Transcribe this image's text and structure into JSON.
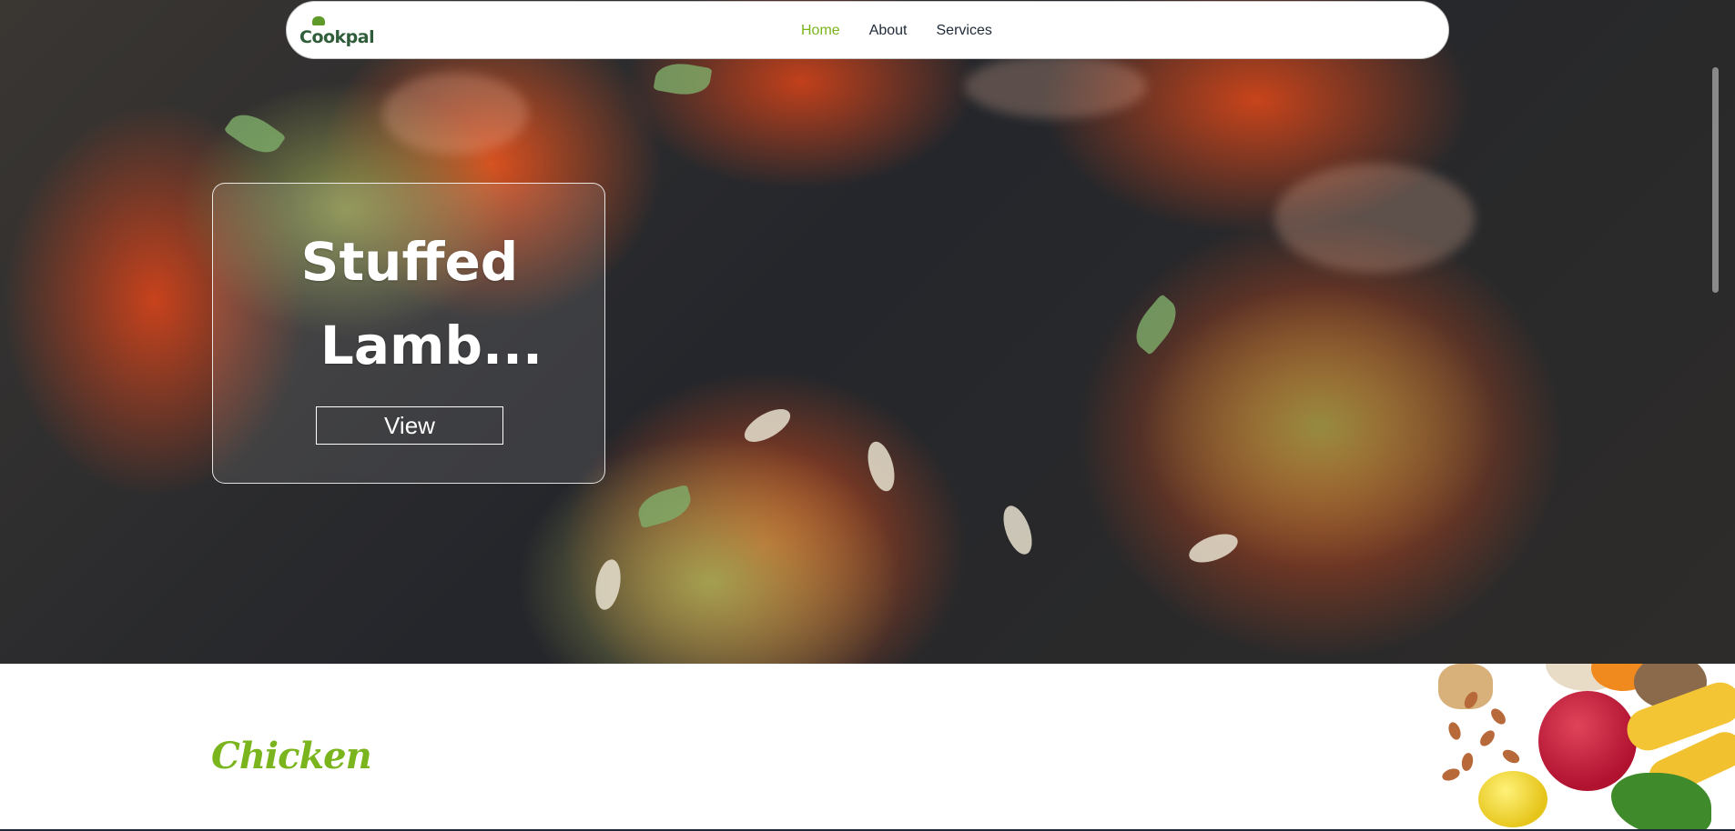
{
  "header": {
    "logo_text": "Cookpal",
    "nav_items": [
      {
        "label": "Home",
        "active": true
      },
      {
        "label": "About",
        "active": false
      },
      {
        "label": "Services",
        "active": false
      }
    ]
  },
  "hero": {
    "image_icon": "stuffed-tomatoes-photo",
    "card": {
      "title_line1": "Stuffed",
      "title_line2": "Lamb...",
      "view_label": "View"
    }
  },
  "section": {
    "heading": "Chicken",
    "decor_icon": "produce-illustration"
  },
  "colors": {
    "accent": "#7ab51d",
    "nav_text": "#1f2937",
    "logo": "#2f5d3a"
  }
}
